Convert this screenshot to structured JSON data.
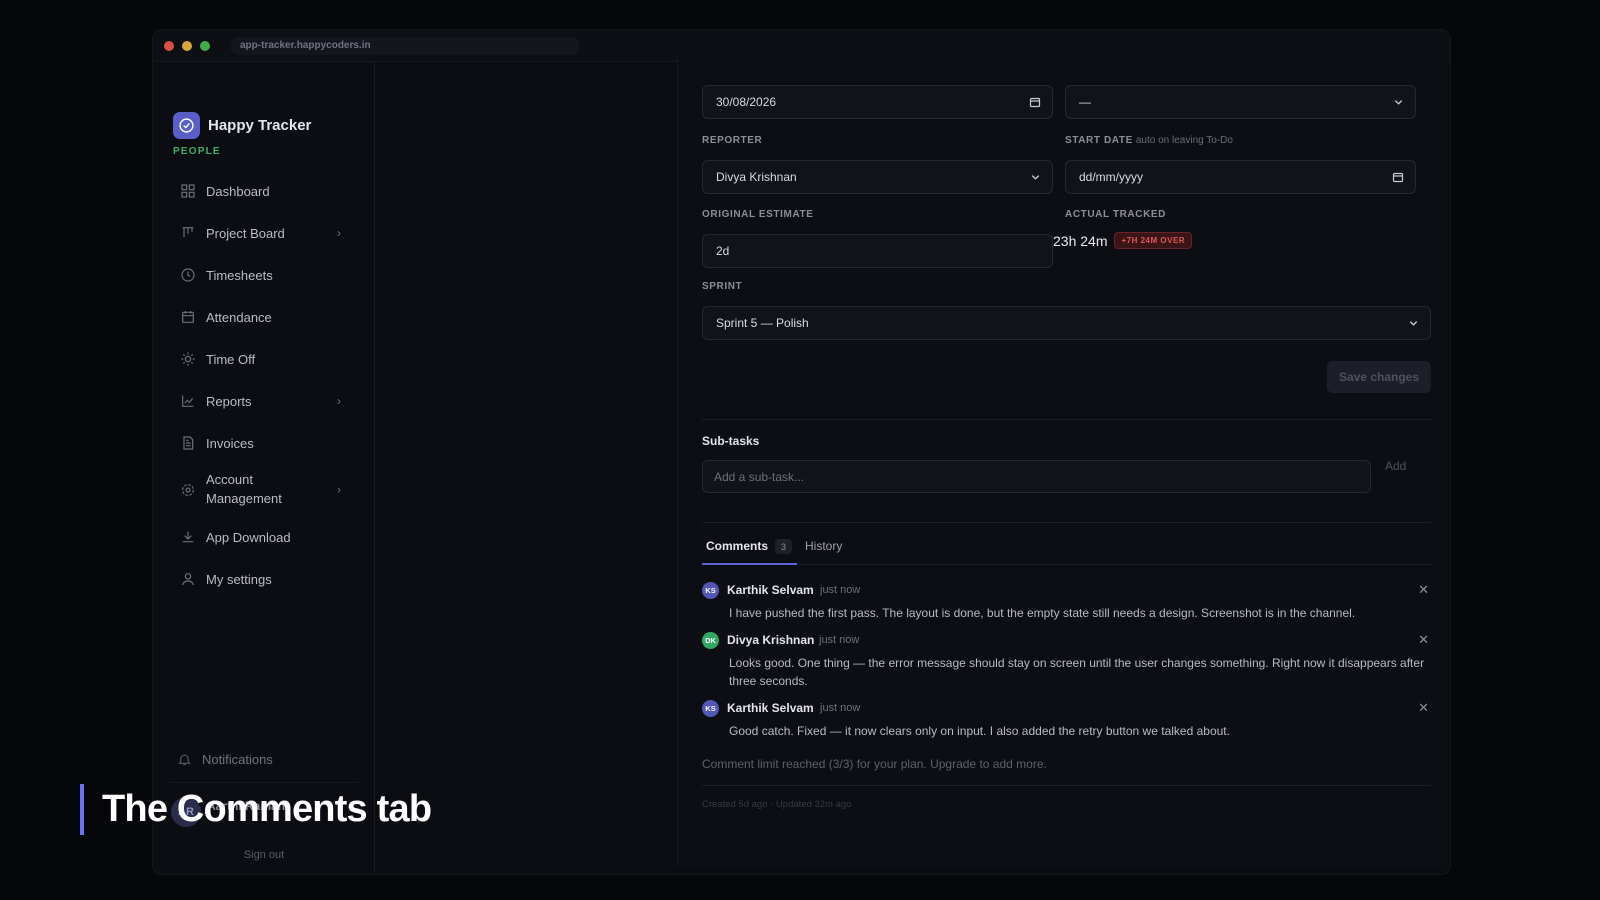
{
  "browser": {
    "url": "app-tracker.happycoders.in"
  },
  "sidebar": {
    "brand_name": "Happy Tracker",
    "brand_sub": "PEOPLE",
    "items": [
      {
        "label": "Dashboard",
        "icon": "grid-icon"
      },
      {
        "label": "Project Board",
        "icon": "kanban-icon",
        "has_chevron": true
      },
      {
        "label": "Timesheets",
        "icon": "clock-icon"
      },
      {
        "label": "Attendance",
        "icon": "calendar-icon"
      },
      {
        "label": "Time Off",
        "icon": "sun-icon"
      },
      {
        "label": "Reports",
        "icon": "chart-icon",
        "has_chevron": true
      },
      {
        "label": "Invoices",
        "icon": "document-icon"
      },
      {
        "label": "Account\nManagement",
        "icon": "gear-icon",
        "has_chevron": true
      },
      {
        "label": "App Download",
        "icon": "download-icon"
      },
      {
        "label": "My settings",
        "icon": "user-icon"
      }
    ],
    "notifications_label": "Notifications",
    "user_name": "Aarthi Raman",
    "user_initials": "AR",
    "signout_label": "Sign out"
  },
  "form": {
    "due_date_value": "30/08/2026",
    "top_right_select_value": "—",
    "reporter_label": "REPORTER",
    "reporter_value": "Divya Krishnan",
    "start_date_label": "START DATE",
    "start_date_note": "auto on leaving To-Do",
    "start_date_placeholder": "dd/mm/yyyy",
    "original_estimate_label": "ORIGINAL ESTIMATE",
    "original_estimate_value": "2d",
    "actual_tracked_label": "ACTUAL TRACKED",
    "actual_tracked_value": "23h 24m",
    "over_badge": "+7H 24M OVER",
    "sprint_label": "SPRINT",
    "sprint_value": "Sprint 5 — Polish",
    "save_label": "Save changes"
  },
  "subtasks": {
    "title": "Sub-tasks",
    "placeholder": "Add a sub-task...",
    "add_label": "Add"
  },
  "tabs": {
    "comments_label": "Comments",
    "comments_count": "3",
    "history_label": "History"
  },
  "comments": [
    {
      "initials": "KS",
      "author": "Karthik Selvam",
      "time": "just now",
      "text": "I have pushed the first pass. The layout is done, but the empty state still needs a design. Screenshot is in the channel."
    },
    {
      "initials": "DK",
      "author": "Divya Krishnan",
      "time": "just now",
      "text": "Looks good. One thing — the error message should stay on screen until the user changes something. Right now it disappears after three seconds."
    },
    {
      "initials": "KS",
      "author": "Karthik Selvam",
      "time": "just now",
      "text": "Good catch. Fixed — it now clears only on input. I also added the retry button we talked about."
    }
  ],
  "comment_limit_text": "Comment limit reached (3/3) for your plan. Upgrade to add more.",
  "meta_text": "Created 5d ago · Updated 32m ago",
  "caption": "The Comments tab",
  "colors": {
    "accent": "#5d63d4",
    "brand_green": "#3fae69",
    "danger": "#e0565a"
  }
}
